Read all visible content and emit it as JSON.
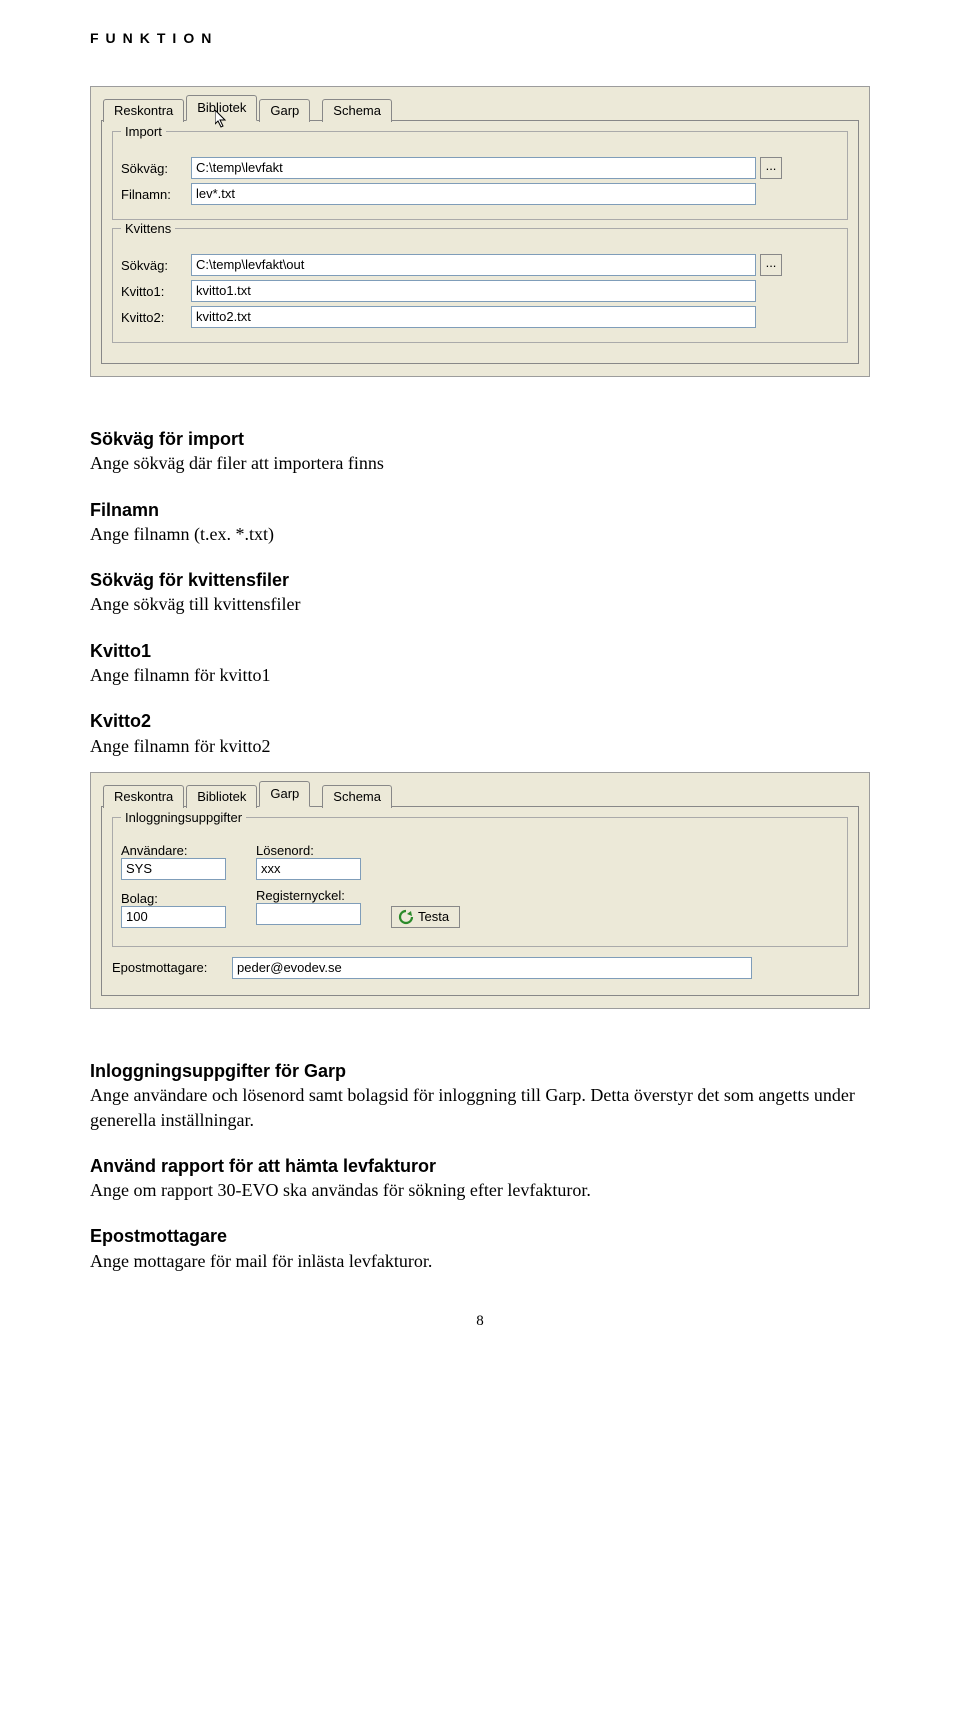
{
  "header": {
    "title": "FUNKTION"
  },
  "dialog1": {
    "tabs": [
      "Reskontra",
      "Bibliotek",
      "Garp",
      "Schema"
    ],
    "active_tab_index": 1,
    "import": {
      "legend": "Import",
      "sokvag_label": "Sökväg:",
      "sokvag_value": "C:\\temp\\levfakt",
      "filnamn_label": "Filnamn:",
      "filnamn_value": "lev*.txt"
    },
    "kvittens": {
      "legend": "Kvittens",
      "sokvag_label": "Sökväg:",
      "sokvag_value": "C:\\temp\\levfakt\\out",
      "kvitto1_label": "Kvitto1:",
      "kvitto1_value": "kvitto1.txt",
      "kvitto2_label": "Kvitto2:",
      "kvitto2_value": "kvitto2.txt"
    },
    "browse_label": "..."
  },
  "section1": {
    "heading": "Sökväg för import",
    "body": "Ange sökväg där filer att importera finns"
  },
  "section2": {
    "heading": "Filnamn",
    "body": "Ange filnamn (t.ex. *.txt)"
  },
  "section3": {
    "heading": "Sökväg för kvittensfiler",
    "body": "Ange sökväg till kvittensfiler"
  },
  "section4": {
    "heading": "Kvitto1",
    "body": "Ange filnamn för kvitto1"
  },
  "section5": {
    "heading": "Kvitto2",
    "body": "Ange filnamn för kvitto2"
  },
  "dialog2": {
    "tabs": [
      "Reskontra",
      "Bibliotek",
      "Garp",
      "Schema"
    ],
    "active_tab_index": 2,
    "inloggning": {
      "legend": "Inloggningsuppgifter",
      "anvandare_label": "Användare:",
      "anvandare_value": "SYS",
      "losenord_label": "Lösenord:",
      "losenord_value": "xxx",
      "bolag_label": "Bolag:",
      "bolag_value": "100",
      "registernyckel_label": "Registernyckel:",
      "registernyckel_value": "",
      "testa_label": "Testa"
    },
    "epost_label": "Epostmottagare:",
    "epost_value": "peder@evodev.se"
  },
  "section6": {
    "heading": "Inloggningsuppgifter för Garp",
    "body": "Ange användare och lösenord samt bolagsid för inloggning till Garp. Detta överstyr det som angetts under generella inställningar."
  },
  "section7": {
    "heading": "Använd rapport för att hämta levfakturor",
    "body": "Ange om rapport 30-EVO ska användas för sökning efter levfakturor."
  },
  "section8": {
    "heading": "Epostmottagare",
    "body": "Ange mottagare för mail för inlästa levfakturor."
  },
  "page_number": "8"
}
